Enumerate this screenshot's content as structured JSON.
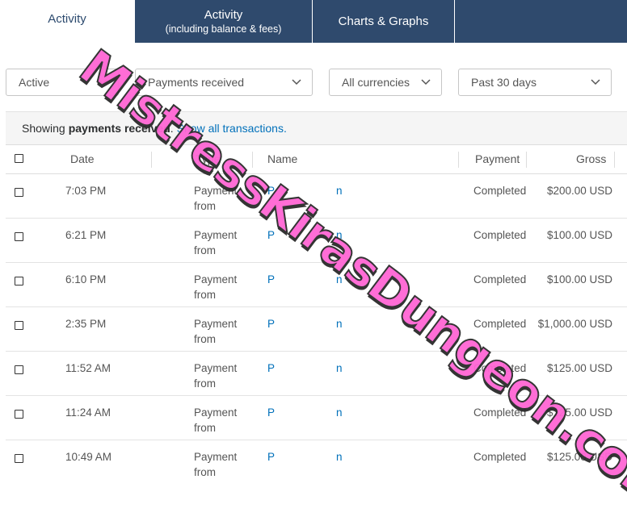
{
  "tabs": [
    {
      "title": "Activity",
      "sub": ""
    },
    {
      "title": "Activity",
      "sub": "(including balance & fees)"
    },
    {
      "title": "Charts & Graphs",
      "sub": ""
    }
  ],
  "filters": {
    "status": "Active",
    "type": "Payments received",
    "currency": "All currencies",
    "period": "Past 30 days"
  },
  "showing": {
    "prefix": "Showing",
    "bold": "payments received",
    "dot": ".",
    "link": "Show all transactions."
  },
  "table": {
    "headers": {
      "date": "Date",
      "type": "Type",
      "name": "Name",
      "payment": "Payment",
      "gross": "Gross"
    },
    "rows": [
      {
        "date": "7:03 PM",
        "type1": "Payment",
        "type2": "from",
        "name1": "P",
        "name2": "n",
        "status": "Completed",
        "gross": "$200.00 USD"
      },
      {
        "date": "6:21 PM",
        "type1": "Payment",
        "type2": "from",
        "name1": "P",
        "name2": "n",
        "status": "Completed",
        "gross": "$100.00 USD"
      },
      {
        "date": "6:10 PM",
        "type1": "Payment",
        "type2": "from",
        "name1": "P",
        "name2": "n",
        "status": "Completed",
        "gross": "$100.00 USD"
      },
      {
        "date": "2:35 PM",
        "type1": "Payment",
        "type2": "from",
        "name1": "P",
        "name2": "n",
        "status": "Completed",
        "gross": "$1,000.00 USD"
      },
      {
        "date": "11:52 AM",
        "type1": "Payment",
        "type2": "from",
        "name1": "P",
        "name2": "n",
        "status": "Completed",
        "gross": "$125.00 USD"
      },
      {
        "date": "11:24 AM",
        "type1": "Payment",
        "type2": "from",
        "name1": "P",
        "name2": "n",
        "status": "Completed",
        "gross": "$125.00 USD"
      },
      {
        "date": "10:49 AM",
        "type1": "Payment",
        "type2": "from",
        "name1": "P",
        "name2": "n",
        "status": "Completed",
        "gross": "$125.00 USD"
      }
    ]
  },
  "watermark": "MistressKirasDungeon.com",
  "colors": {
    "tab_dark": "#2f4a6d",
    "link": "#0070ba",
    "watermark": "#ff66d4"
  }
}
